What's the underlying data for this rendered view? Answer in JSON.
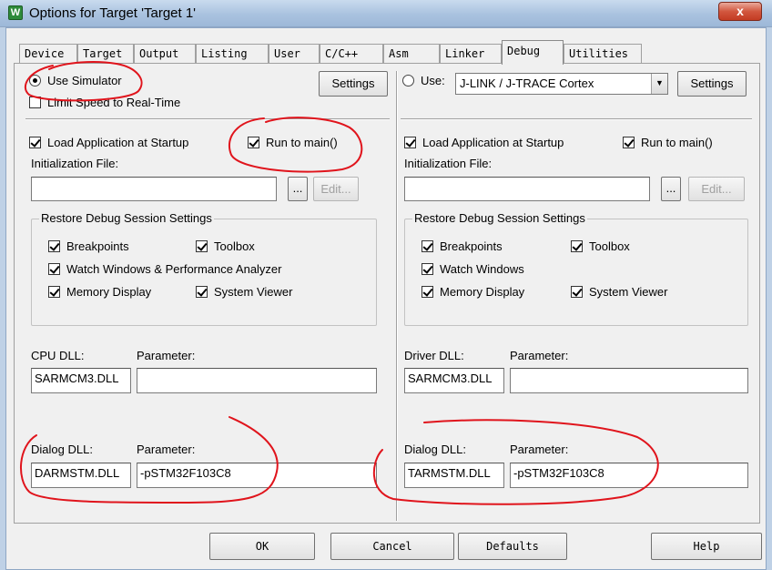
{
  "window": {
    "title": "Options for Target 'Target 1'",
    "close_label": "x",
    "app_icon": "keil-uvision-icon"
  },
  "tabs": [
    "Device",
    "Target",
    "Output",
    "Listing",
    "User",
    "C/C++",
    "Asm",
    "Linker",
    "Debug",
    "Utilities"
  ],
  "active_tab": "Debug",
  "left": {
    "use_simulator": "Use Simulator",
    "settings": "Settings",
    "limit_speed": "Limit Speed to Real-Time",
    "load_app": "Load Application at Startup",
    "run_to_main": "Run to main()",
    "init_file": "Initialization File:",
    "init_value": "",
    "browse": "...",
    "edit": "Edit...",
    "restore_group": "Restore Debug Session Settings",
    "breakpoints": "Breakpoints",
    "toolbox": "Toolbox",
    "watch": "Watch Windows & Performance Analyzer",
    "memory": "Memory Display",
    "system_viewer": "System Viewer",
    "cpu_dll": "CPU DLL:",
    "cpu_dll_value": "SARMCM3.DLL",
    "cpu_param_label": "Parameter:",
    "cpu_param_value": "",
    "dialog_dll": "Dialog DLL:",
    "dialog_dll_value": "DARMSTM.DLL",
    "dialog_param_label": "Parameter:",
    "dialog_param_value": "-pSTM32F103C8"
  },
  "right": {
    "use": "Use:",
    "driver": "J-LINK / J-TRACE Cortex",
    "settings": "Settings",
    "load_app": "Load Application at Startup",
    "run_to_main": "Run to main()",
    "init_file": "Initialization File:",
    "init_value": "",
    "browse": "...",
    "edit": "Edit...",
    "restore_group": "Restore Debug Session Settings",
    "breakpoints": "Breakpoints",
    "toolbox": "Toolbox",
    "watch": "Watch Windows",
    "memory": "Memory Display",
    "system_viewer": "System Viewer",
    "driver_dll": "Driver DLL:",
    "driver_dll_value": "SARMCM3.DLL",
    "driver_param_label": "Parameter:",
    "driver_param_value": "",
    "dialog_dll": "Dialog DLL:",
    "dialog_dll_value": "TARMSTM.DLL",
    "dialog_param_label": "Parameter:",
    "dialog_param_value": "-pSTM32F103C8"
  },
  "footer": {
    "ok": "OK",
    "cancel": "Cancel",
    "defaults": "Defaults",
    "help": "Help"
  },
  "colors": {
    "annotation": "#e0141c",
    "title_bar": "#a9c2df",
    "close_button": "#c33b22"
  }
}
